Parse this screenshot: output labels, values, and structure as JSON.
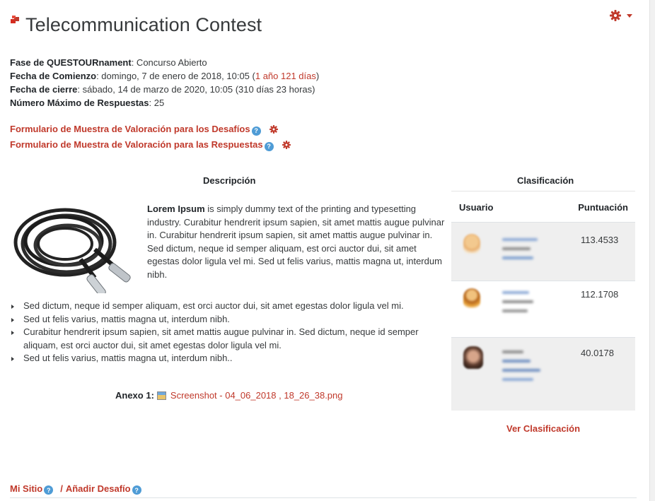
{
  "header": {
    "title": "Telecommunication Contest"
  },
  "info": {
    "phase_label": "Fase de QUESTOURnament",
    "phase_value": ": Concurso Abierto",
    "start_label": "Fecha de Comienzo",
    "start_value": ": domingo, 7 de enero de 2018, 10:05 (",
    "start_elapsed": "1 año 121 días",
    "start_close": ")",
    "end_label": "Fecha de cierre",
    "end_value": ": sábado, 14 de marzo de 2020, 10:05 (310 días 23 horas)",
    "max_label": "Número Máximo de Respuestas",
    "max_value": ": 25"
  },
  "forms": {
    "challenges_link": "Formulario de Muestra de Valoración para los Desafíos",
    "answers_link": "Formulario de Muestra de Valoración para las Respuestas"
  },
  "description": {
    "title": "Descripción",
    "lead": "Lorem Ipsum",
    "text": " is simply dummy text of the printing and typesetting industry. Curabitur hendrerit ipsum sapien, sit amet mattis augue pulvinar in. Curabitur hendrerit ipsum sapien, sit amet mattis augue pulvinar in. Sed dictum, neque id semper aliquam, est orci auctor dui, sit amet egestas dolor ligula vel mi. Sed ut felis varius, mattis magna ut, interdum nibh.",
    "bullets": [
      "Sed dictum, neque id semper aliquam, est orci auctor dui, sit amet egestas dolor ligula vel mi.",
      "Sed ut felis varius, mattis magna ut, interdum nibh.",
      "Curabitur hendrerit ipsum sapien, sit amet mattis augue pulvinar in. Sed dictum, neque id semper aliquam, est orci auctor dui, sit amet egestas dolor ligula vel mi.",
      "Sed ut felis varius, mattis magna ut, interdum nibh.."
    ],
    "annex_label": "Anexo 1:",
    "annex_file": "Screenshot - 04_06_2018 , 18_26_38.png"
  },
  "classification": {
    "title": "Clasificación",
    "col_user": "Usuario",
    "col_score": "Puntuación",
    "rows": [
      {
        "score": "113.4533"
      },
      {
        "score": "112.1708"
      },
      {
        "score": "40.0178"
      }
    ],
    "view_link": "Ver Clasificación"
  },
  "footer": {
    "my_site": "Mi Sitio",
    "separator": "/",
    "add_challenge": "Añadir Desafío"
  },
  "colors": {
    "accent": "#c0392b",
    "help": "#4f9cd6"
  }
}
